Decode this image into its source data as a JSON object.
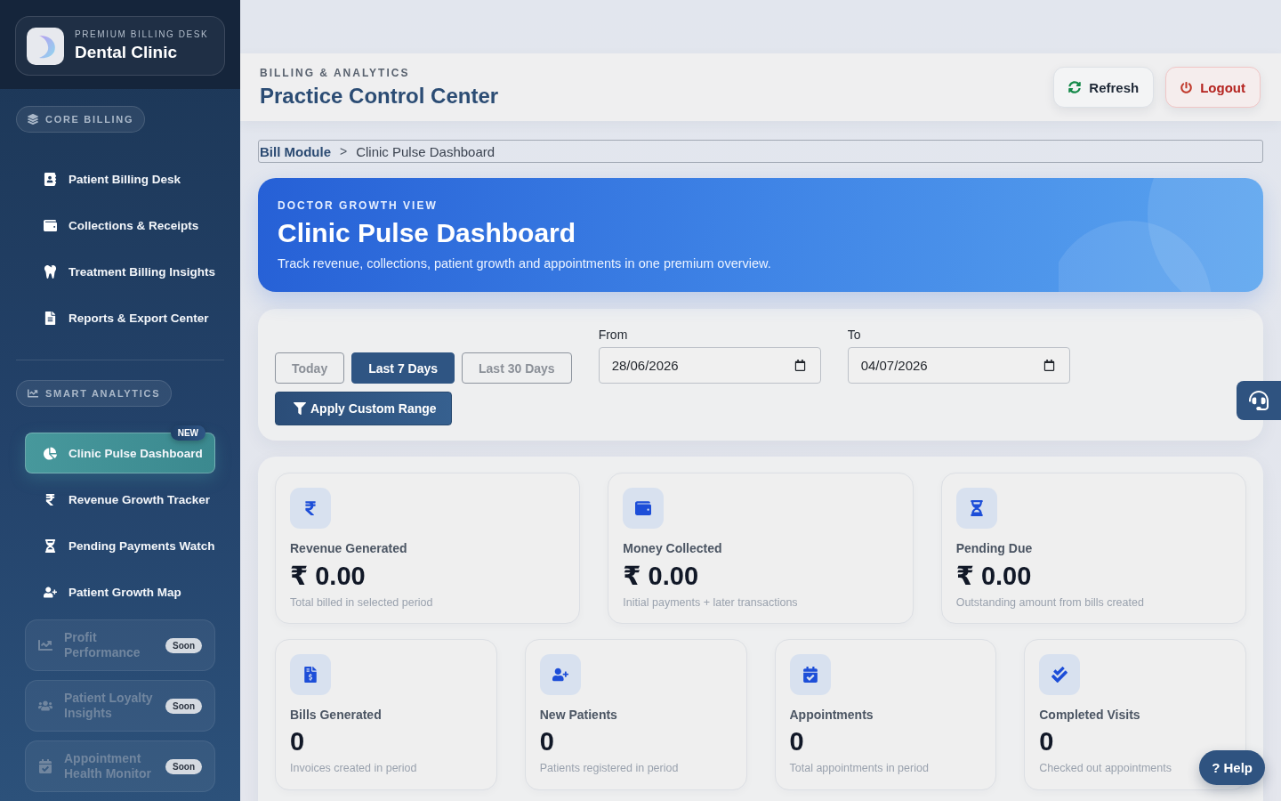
{
  "brand": {
    "eyebrow": "PREMIUM BILLING DESK",
    "name": "Dental Clinic"
  },
  "sidebar": {
    "sections": [
      {
        "title": "CORE BILLING",
        "items": [
          {
            "label": "Patient Billing Desk",
            "selected": false,
            "disabled": false
          },
          {
            "label": "Collections & Receipts",
            "selected": false,
            "disabled": false
          },
          {
            "label": "Treatment Billing Insights",
            "selected": false,
            "disabled": false
          },
          {
            "label": "Reports & Export Center",
            "selected": false,
            "disabled": false
          }
        ]
      },
      {
        "title": "SMART ANALYTICS",
        "items": [
          {
            "label": "Clinic Pulse Dashboard",
            "selected": true,
            "disabled": false,
            "badge": "NEW"
          },
          {
            "label": "Revenue Growth Tracker",
            "selected": false,
            "disabled": false
          },
          {
            "label": "Pending Payments Watch",
            "selected": false,
            "disabled": false
          },
          {
            "label": "Patient Growth Map",
            "selected": false,
            "disabled": false
          },
          {
            "label": "Profit Performance",
            "selected": false,
            "disabled": true,
            "badge": "Soon"
          },
          {
            "label": "Patient Loyalty Insights",
            "selected": false,
            "disabled": true,
            "badge": "Soon"
          },
          {
            "label": "Appointment Health Monitor",
            "selected": false,
            "disabled": true,
            "badge": "Soon"
          }
        ]
      }
    ]
  },
  "header": {
    "eyebrow": "BILLING & ANALYTICS",
    "title": "Practice Control Center",
    "actions": [
      {
        "label": "Refresh",
        "kind": "refresh"
      },
      {
        "label": "Logout",
        "kind": "logout"
      }
    ]
  },
  "breadcrumb": {
    "items": [
      {
        "label": "Bill Module",
        "current": false
      },
      {
        "label": "Clinic Pulse Dashboard",
        "current": true
      }
    ],
    "separator": ">"
  },
  "hero": {
    "eyebrow": "DOCTOR GROWTH VIEW",
    "title": "Clinic Pulse Dashboard",
    "subtitle": "Track revenue, collections, patient growth and appointments in one premium overview."
  },
  "filters": {
    "ranges": [
      {
        "label": "Today",
        "selected": false
      },
      {
        "label": "Last 7 Days",
        "selected": true
      },
      {
        "label": "Last 30 Days",
        "selected": false
      }
    ],
    "apply": "Apply Custom Range",
    "from": {
      "label": "From",
      "value": "28/06/2026"
    },
    "to": {
      "label": "To",
      "value": "04/07/2026"
    }
  },
  "summary": {
    "primary": [
      {
        "label": "Revenue Generated",
        "value": "₹ 0.00",
        "note": "Total billed in selected period"
      },
      {
        "label": "Money Collected",
        "value": "₹ 0.00",
        "note": "Initial payments + later transactions"
      },
      {
        "label": "Pending Due",
        "value": "₹ 0.00",
        "note": "Outstanding amount from bills created"
      }
    ],
    "secondary": [
      {
        "label": "Bills Generated",
        "value": "0",
        "note": "Invoices created in period"
      },
      {
        "label": "New Patients",
        "value": "0",
        "note": "Patients registered in period"
      },
      {
        "label": "Appointments",
        "value": "0",
        "note": "Total appointments in period"
      },
      {
        "label": "Completed Visits",
        "value": "0",
        "note": "Checked out appointments"
      }
    ]
  },
  "help": {
    "label": "? Help"
  }
}
